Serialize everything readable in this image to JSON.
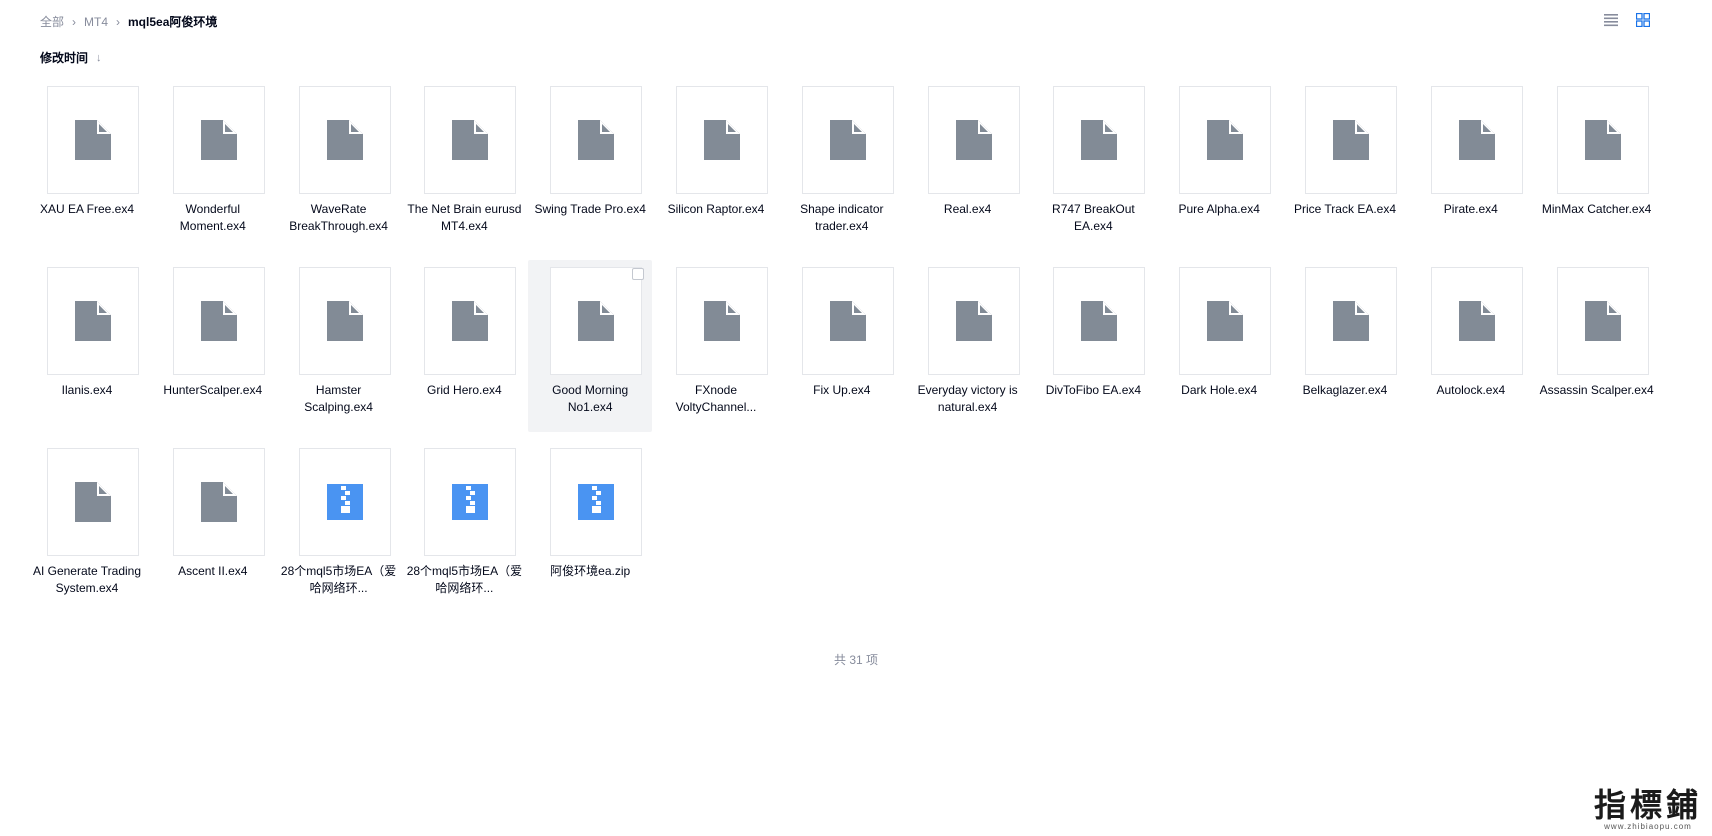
{
  "breadcrumb": {
    "items": [
      "全部",
      "MT4"
    ],
    "current": "mql5ea阿俊环境"
  },
  "view_switch": {
    "list_icon": "list-view-icon",
    "grid_icon": "grid-view-icon",
    "active": "grid"
  },
  "sort": {
    "label": "修改时间",
    "direction_icon": "arrow-down-icon"
  },
  "files": [
    {
      "name": "XAU EA Free.ex4",
      "type": "file"
    },
    {
      "name": "Wonderful Moment.ex4",
      "type": "file"
    },
    {
      "name": "WaveRate BreakThrough.ex4",
      "type": "file"
    },
    {
      "name": "The Net Brain eurusd MT4.ex4",
      "type": "file"
    },
    {
      "name": "Swing Trade Pro.ex4",
      "type": "file"
    },
    {
      "name": "Silicon Raptor.ex4",
      "type": "file"
    },
    {
      "name": "Shape indicator trader.ex4",
      "type": "file"
    },
    {
      "name": "Real.ex4",
      "type": "file"
    },
    {
      "name": "R747 BreakOut EA.ex4",
      "type": "file"
    },
    {
      "name": "Pure Alpha.ex4",
      "type": "file"
    },
    {
      "name": "Price Track EA.ex4",
      "type": "file"
    },
    {
      "name": "Pirate.ex4",
      "type": "file"
    },
    {
      "name": "MinMax Catcher.ex4",
      "type": "file"
    },
    {
      "name": "Ilanis.ex4",
      "type": "file"
    },
    {
      "name": "HunterScalper.ex4",
      "type": "file"
    },
    {
      "name": "Hamster Scalping.ex4",
      "type": "file"
    },
    {
      "name": "Grid Hero.ex4",
      "type": "file"
    },
    {
      "name": "Good Morning No1.ex4",
      "type": "file",
      "hovered": true
    },
    {
      "name": "FXnode VoltyChannel...",
      "type": "file"
    },
    {
      "name": "Fix Up.ex4",
      "type": "file"
    },
    {
      "name": "Everyday victory is natural.ex4",
      "type": "file"
    },
    {
      "name": "DivToFibo EA.ex4",
      "type": "file"
    },
    {
      "name": "Dark Hole.ex4",
      "type": "file"
    },
    {
      "name": "Belkaglazer.ex4",
      "type": "file"
    },
    {
      "name": "Autolock.ex4",
      "type": "file"
    },
    {
      "name": "Assassin Scalper.ex4",
      "type": "file"
    },
    {
      "name": "AI Generate Trading System.ex4",
      "type": "file"
    },
    {
      "name": "Ascent II.ex4",
      "type": "file"
    },
    {
      "name": "28个mql5市场EA（爱哈网络环...",
      "type": "zip"
    },
    {
      "name": "28个mql5市场EA（爱哈网络环...",
      "type": "zip"
    },
    {
      "name": "阿俊环境ea.zip",
      "type": "zip"
    }
  ],
  "footer": {
    "count_text": "共 31 项"
  },
  "watermark": {
    "main": "指標鋪",
    "sub": "www.zhibiaopu.com"
  },
  "colors": {
    "file_icon": "#828b96",
    "zip_icon": "#4a94f2",
    "accent": "#1a73e8"
  }
}
